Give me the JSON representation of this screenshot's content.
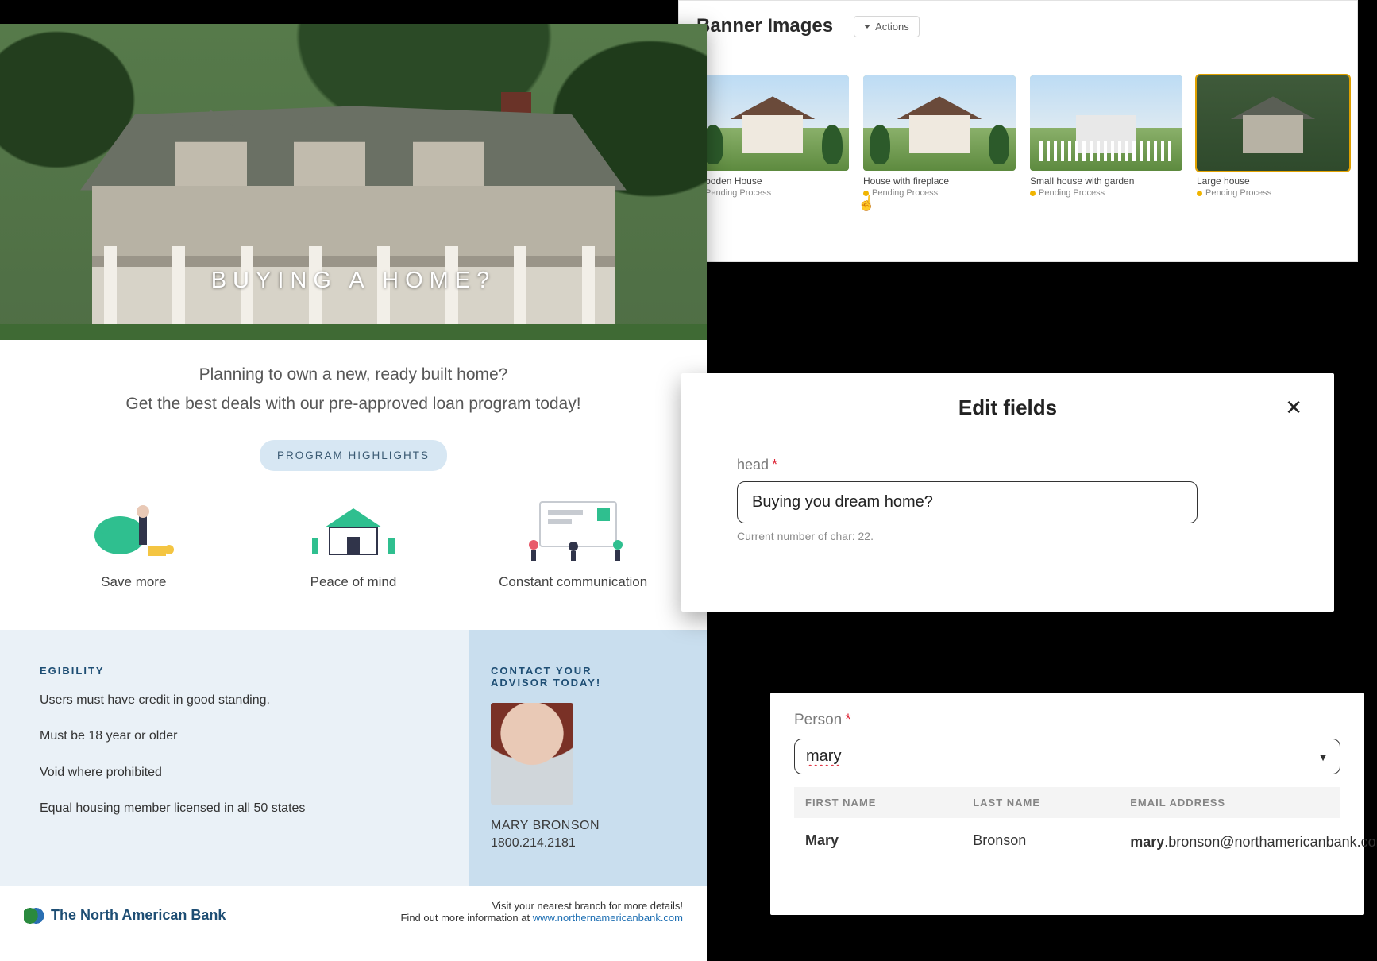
{
  "banner_panel": {
    "title": "Banner Images",
    "actions_label": "Actions",
    "items": [
      {
        "caption": "Wooden House",
        "status": "Pending Process",
        "selected": false
      },
      {
        "caption": "House with fireplace",
        "status": "Pending Process",
        "selected": false
      },
      {
        "caption": "Small house with garden",
        "status": "Pending Process",
        "selected": false
      },
      {
        "caption": "Large house",
        "status": "Pending Process",
        "selected": true
      }
    ]
  },
  "flyer": {
    "hero_title": "BUYING A HOME?",
    "intro_line1": "Planning to own a new, ready built home?",
    "intro_line2": "Get the best deals with our pre-approved loan program today!",
    "highlights_badge": "PROGRAM HIGHLIGHTS",
    "highlights": [
      {
        "label": "Save more"
      },
      {
        "label": "Peace of mind"
      },
      {
        "label": "Constant communication"
      }
    ],
    "eligibility": {
      "heading": "EGIBILITY",
      "lines": [
        "Users must have credit in good standing.",
        "Must be 18 year or older",
        "Void where prohibited",
        "Equal housing member licensed in all 50 states"
      ]
    },
    "contact": {
      "heading_l1": "CONTACT YOUR",
      "heading_l2": "ADVISOR TODAY!",
      "name": "MARY BRONSON",
      "phone": "1800.214.2181"
    },
    "footer": {
      "brand": "The North American Bank",
      "line1": "Visit your nearest branch for more details!",
      "line2_prefix": "Find out more information at ",
      "link": "www.northernamericanbank.com"
    }
  },
  "edit_modal": {
    "title": "Edit fields",
    "field_label": "head",
    "value": "Buying you dream home?",
    "helper": "Current number of char: 22."
  },
  "person_panel": {
    "label": "Person",
    "search_value": "mary",
    "columns": [
      "FIRST NAME",
      "LAST NAME",
      "EMAIL ADDRESS"
    ],
    "row": {
      "first": "Mary",
      "last": "Bronson",
      "email_bold": "mary",
      "email_rest": ".bronson@northamericanbank.com"
    }
  }
}
